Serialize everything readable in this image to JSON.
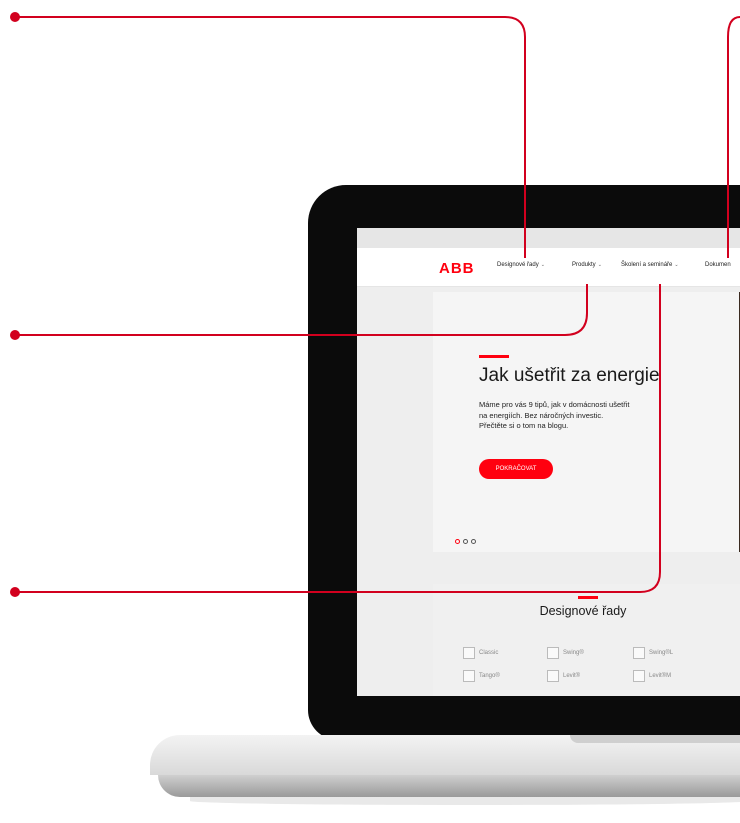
{
  "nav": {
    "logo": "ABB",
    "items": [
      {
        "label": "Designové řady"
      },
      {
        "label": "Produkty"
      },
      {
        "label": "Školení a semináře"
      },
      {
        "label": "Dokumen"
      }
    ],
    "caret": "⌄"
  },
  "hero": {
    "title": "Jak ušetřit za energie",
    "text_lines": [
      "Máme pro vás 9 tipů, jak v domácnosti ušetřit",
      "na energiích. Bez náročných investic.",
      "Přečtěte si o tom na blogu."
    ],
    "button_label": "POKRAČOVAT",
    "slides_total": 3,
    "active_slide": 1
  },
  "design_series": {
    "title": "Designové řady",
    "items": [
      "Classic",
      "Swing®",
      "Swing®L",
      "Tango®",
      "Levit®",
      "Levit®M"
    ]
  },
  "colors": {
    "accent": "#ff000f",
    "callout": "#d2001e",
    "laptop": "#0b0b0b"
  }
}
